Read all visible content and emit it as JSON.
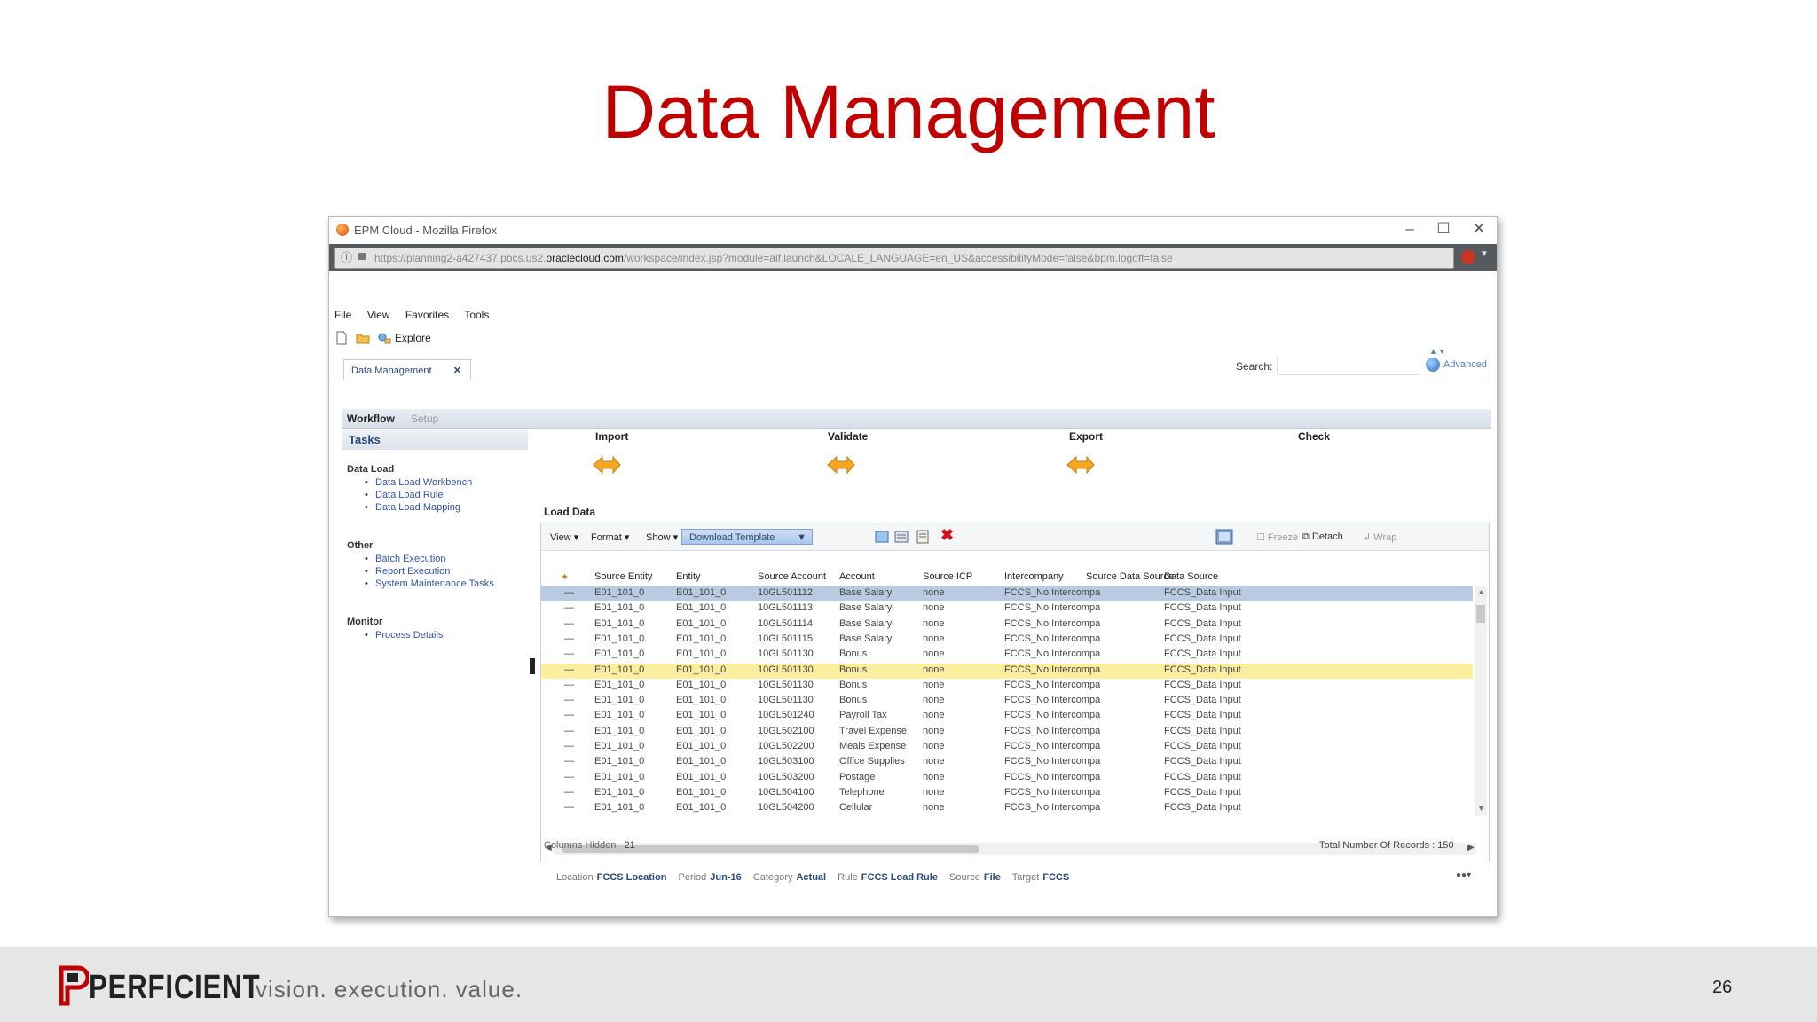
{
  "slide": {
    "title": "Data Management",
    "page_number": "26"
  },
  "footer": {
    "logo": "PERFICIENT",
    "tagline": "vision.  execution.  value."
  },
  "browser": {
    "title": "EPM Cloud - Mozilla Firefox",
    "url_prefix": "https://planning2-a427437.pbcs.us2.",
    "url_domain": "oraclecloud.com",
    "url_suffix": "/workspace/index.jsp?module=aif.launch&LOCALE_LANGUAGE=en_US&accessibilityMode=false&bpm.logoff=false"
  },
  "menu": [
    "File",
    "View",
    "Favorites",
    "Tools"
  ],
  "toolbar": {
    "explore": "Explore"
  },
  "doc_tab": {
    "label": "Data Management"
  },
  "search": {
    "label": "Search:",
    "advanced": "Advanced"
  },
  "workflow_tabs": [
    "Workflow",
    "Setup"
  ],
  "tasks": {
    "header": "Tasks",
    "groups": [
      {
        "name": "Data Load",
        "items": [
          "Data Load Workbench",
          "Data Load Rule",
          "Data Load Mapping"
        ]
      },
      {
        "name": "Other",
        "items": [
          "Batch Execution",
          "Report Execution",
          "System Maintenance Tasks"
        ]
      },
      {
        "name": "Monitor",
        "items": [
          "Process Details"
        ]
      }
    ]
  },
  "steps": [
    "Import",
    "Validate",
    "Export",
    "Check"
  ],
  "load_data": {
    "title": "Load Data",
    "view": "View ▾",
    "format": "Format ▾",
    "show": "Show ▾",
    "download_template": "Download Template",
    "freeze": "Freeze",
    "detach": "Detach",
    "wrap": "Wrap"
  },
  "table": {
    "columns": [
      "Source Entity",
      "Entity",
      "Source Account",
      "Account",
      "Source ICP",
      "Intercompany",
      "Source Data Source",
      "Data Source"
    ],
    "rows": [
      [
        "E01_101_0",
        "E01_101_0",
        "10GL501112",
        "Base Salary",
        "none",
        "FCCS_No Intercompa",
        "",
        "FCCS_Data Input"
      ],
      [
        "E01_101_0",
        "E01_101_0",
        "10GL501113",
        "Base Salary",
        "none",
        "FCCS_No Intercompa",
        "",
        "FCCS_Data Input"
      ],
      [
        "E01_101_0",
        "E01_101_0",
        "10GL501114",
        "Base Salary",
        "none",
        "FCCS_No Intercompa",
        "",
        "FCCS_Data Input"
      ],
      [
        "E01_101_0",
        "E01_101_0",
        "10GL501115",
        "Base Salary",
        "none",
        "FCCS_No Intercompa",
        "",
        "FCCS_Data Input"
      ],
      [
        "E01_101_0",
        "E01_101_0",
        "10GL501130",
        "Bonus",
        "none",
        "FCCS_No Intercompa",
        "",
        "FCCS_Data Input"
      ],
      [
        "E01_101_0",
        "E01_101_0",
        "10GL501130",
        "Bonus",
        "none",
        "FCCS_No Intercompa",
        "",
        "FCCS_Data Input"
      ],
      [
        "E01_101_0",
        "E01_101_0",
        "10GL501130",
        "Bonus",
        "none",
        "FCCS_No Intercompa",
        "",
        "FCCS_Data Input"
      ],
      [
        "E01_101_0",
        "E01_101_0",
        "10GL501130",
        "Bonus",
        "none",
        "FCCS_No Intercompa",
        "",
        "FCCS_Data Input"
      ],
      [
        "E01_101_0",
        "E01_101_0",
        "10GL501240",
        "Payroll Tax",
        "none",
        "FCCS_No Intercompa",
        "",
        "FCCS_Data Input"
      ],
      [
        "E01_101_0",
        "E01_101_0",
        "10GL502100",
        "Travel Expense",
        "none",
        "FCCS_No Intercompa",
        "",
        "FCCS_Data Input"
      ],
      [
        "E01_101_0",
        "E01_101_0",
        "10GL502200",
        "Meals Expense",
        "none",
        "FCCS_No Intercompa",
        "",
        "FCCS_Data Input"
      ],
      [
        "E01_101_0",
        "E01_101_0",
        "10GL503100",
        "Office Supplies",
        "none",
        "FCCS_No Intercompa",
        "",
        "FCCS_Data Input"
      ],
      [
        "E01_101_0",
        "E01_101_0",
        "10GL503200",
        "Postage",
        "none",
        "FCCS_No Intercompa",
        "",
        "FCCS_Data Input"
      ],
      [
        "E01_101_0",
        "E01_101_0",
        "10GL504100",
        "Telephone",
        "none",
        "FCCS_No Intercompa",
        "",
        "FCCS_Data Input"
      ],
      [
        "E01_101_0",
        "E01_101_0",
        "10GL504200",
        "Cellular",
        "none",
        "FCCS_No Intercompa",
        "",
        "FCCS_Data Input"
      ]
    ],
    "selected_row": 0,
    "highlighted_row": 5
  },
  "grid_footer": {
    "columns_hidden_label": "Columns Hidden",
    "columns_hidden": "21",
    "total_records": "Total Number Of Records : 150"
  },
  "pov": {
    "location_label": "Location",
    "location": "FCCS Location",
    "period_label": "Period",
    "period": "Jun-16",
    "category_label": "Category",
    "category": "Actual",
    "rule_label": "Rule",
    "rule": "FCCS Load Rule",
    "source_label": "Source",
    "source": "File",
    "target_label": "Target",
    "target": "FCCS"
  },
  "colors": {
    "title_red": "#c00000",
    "delete_red": "#d0141b",
    "selected_row": "#b8cbe0",
    "highlight_row": "#fbee9e",
    "link_blue": "#3553a8"
  },
  "icons": [
    "firefox-icon",
    "lock-icon",
    "new-doc-icon",
    "open-folder-icon",
    "explore-icon",
    "globe-icon",
    "step-arrow-icon",
    "delete-icon"
  ]
}
